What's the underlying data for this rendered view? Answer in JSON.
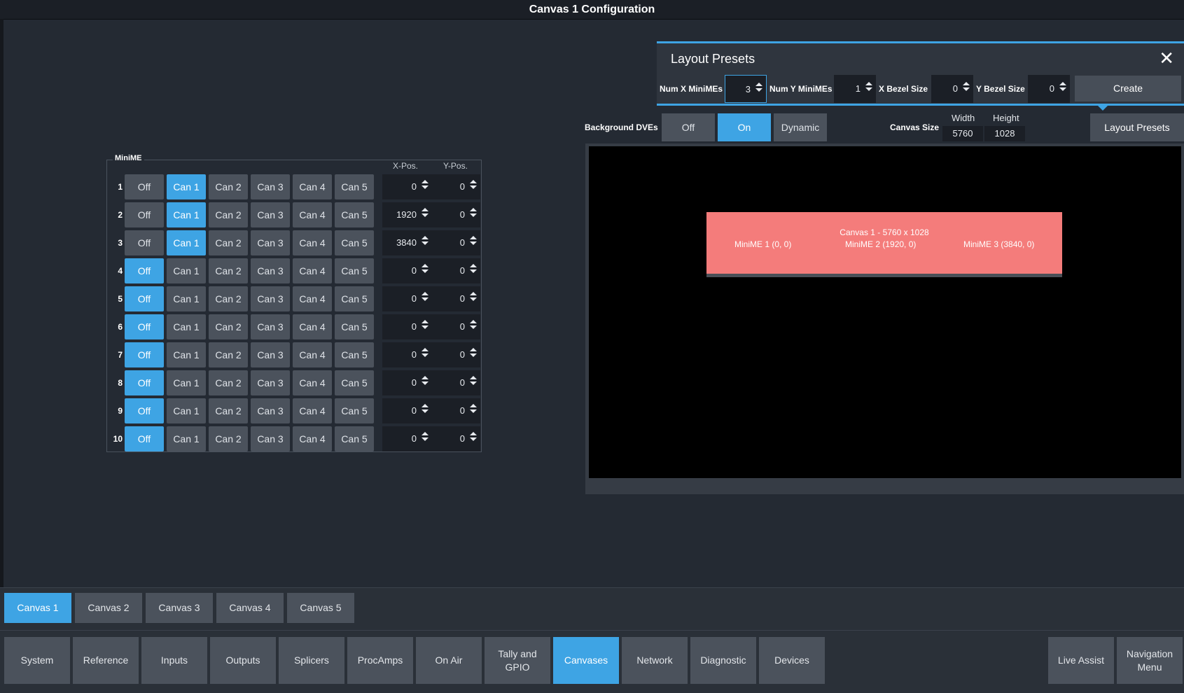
{
  "window": {
    "title": "Canvas 1 Configuration"
  },
  "minime": {
    "title": "MiniME",
    "col_xpos": "X-Pos.",
    "col_ypos": "Y-Pos.",
    "option_labels": [
      "Off",
      "Can 1",
      "Can 2",
      "Can 3",
      "Can 4",
      "Can 5"
    ],
    "rows": [
      {
        "num": "1",
        "selected": 1,
        "x": "0",
        "y": "0"
      },
      {
        "num": "2",
        "selected": 1,
        "x": "1920",
        "y": "0"
      },
      {
        "num": "3",
        "selected": 1,
        "x": "3840",
        "y": "0"
      },
      {
        "num": "4",
        "selected": 0,
        "x": "0",
        "y": "0"
      },
      {
        "num": "5",
        "selected": 0,
        "x": "0",
        "y": "0"
      },
      {
        "num": "6",
        "selected": 0,
        "x": "0",
        "y": "0"
      },
      {
        "num": "7",
        "selected": 0,
        "x": "0",
        "y": "0"
      },
      {
        "num": "8",
        "selected": 0,
        "x": "0",
        "y": "0"
      },
      {
        "num": "9",
        "selected": 0,
        "x": "0",
        "y": "0"
      },
      {
        "num": "10",
        "selected": 0,
        "x": "0",
        "y": "0"
      }
    ]
  },
  "layout_presets": {
    "title": "Layout Presets",
    "close_icon": "close-icon",
    "num_x_label": "Num X MiniMEs",
    "num_x_value": "3",
    "num_y_label": "Num Y MiniMEs",
    "num_y_value": "1",
    "x_bezel_label": "X Bezel Size",
    "x_bezel_value": "0",
    "y_bezel_label": "Y Bezel Size",
    "y_bezel_value": "0",
    "create_label": "Create"
  },
  "background_dves": {
    "label": "Background DVEs",
    "options": [
      "Off",
      "On",
      "Dynamic"
    ],
    "selected": "On"
  },
  "canvas_size": {
    "label": "Canvas Size",
    "width_label": "Width",
    "height_label": "Height",
    "width": "5760",
    "height": "1028"
  },
  "layout_presets_button": "Layout Presets",
  "preview": {
    "canvas_title": "Canvas 1 - 5760 x 1028",
    "minimes": [
      "MiniME 1 (0, 0)",
      "MiniME 2 (1920, 0)",
      "MiniME 3 (3840, 0)"
    ],
    "canvas_color": "#f47c7b"
  },
  "canvas_tabs": [
    "Canvas 1",
    "Canvas 2",
    "Canvas 3",
    "Canvas 4",
    "Canvas 5"
  ],
  "canvas_tab_active": 0,
  "nav": [
    "System",
    "Reference",
    "Inputs",
    "Outputs",
    "Splicers",
    "ProcAmps",
    "On Air",
    "Tally and GPIO",
    "Canvases",
    "Network",
    "Diagnostic",
    "Devices"
  ],
  "nav_active": 8,
  "nav_right": [
    "Live Assist",
    "Navigation Menu"
  ],
  "colors": {
    "accent": "#3ea4e4",
    "button": "#4b525c",
    "background": "#242a33"
  }
}
